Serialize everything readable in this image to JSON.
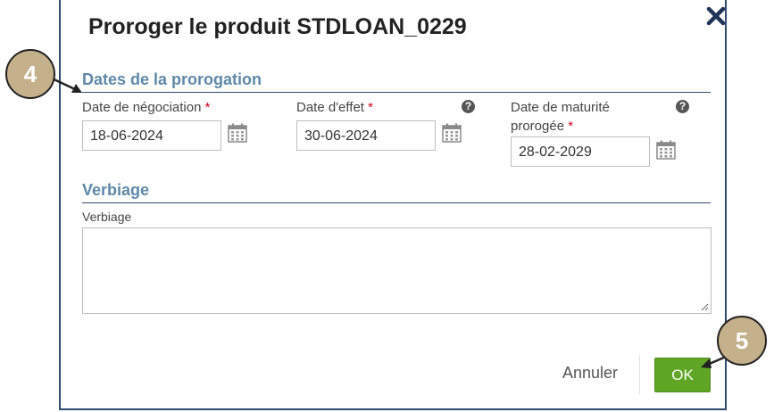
{
  "dialog": {
    "title": "Proroger le produit STDLOAN_0229",
    "close_icon": "close-icon"
  },
  "dates_section": {
    "heading": "Dates de la prorogation",
    "negotiation": {
      "label": "Date de négociation",
      "required": "*",
      "value": "18-06-2024"
    },
    "effect": {
      "label": "Date d'effet",
      "required": "*",
      "value": "30-06-2024",
      "help": "?"
    },
    "maturity": {
      "label_line1": "Date de maturité",
      "label_line2": "prorogée",
      "required": "*",
      "value": "28-02-2029",
      "help": "?"
    }
  },
  "verbiage_section": {
    "heading": "Verbiage",
    "field_label": "Verbiage",
    "value": ""
  },
  "footer": {
    "cancel_label": "Annuler",
    "ok_label": "OK"
  },
  "callouts": {
    "step_4": "4",
    "step_5": "5"
  },
  "colors": {
    "section_heading": "#5f88a8",
    "ok_button": "#5fa624",
    "badge": "#c4b08a",
    "border": "#2f4a6d",
    "required": "#d0021b"
  }
}
